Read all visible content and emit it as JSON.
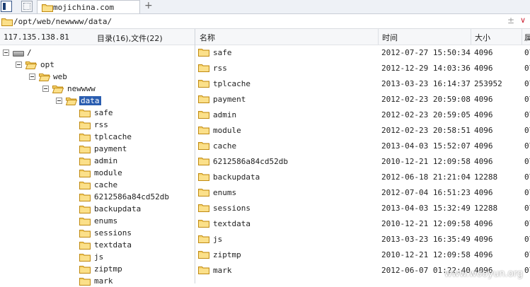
{
  "tab": {
    "title": "mojichina.com",
    "new_tab": "+"
  },
  "pathbar": {
    "path": "/opt/web/newwww/data/",
    "up_icon": "±",
    "dropdown_icon": "∨"
  },
  "info": {
    "ip": "117.135.138.81",
    "summary": "目录(16),文件(22)"
  },
  "columns": {
    "name": "名称",
    "time": "时间",
    "size": "大小",
    "perm": "属"
  },
  "tree": {
    "root": "/",
    "opt": "opt",
    "web": "web",
    "newwww": "newwww",
    "data": "data",
    "children": [
      "safe",
      "rss",
      "tplcache",
      "payment",
      "admin",
      "module",
      "cache",
      "6212586a84cd52db",
      "backupdata",
      "enums",
      "sessions",
      "textdata",
      "js",
      "ziptmp",
      "mark"
    ]
  },
  "files": [
    {
      "name": "safe",
      "time": "2012-07-27 15:50:34",
      "size": "4096",
      "perm": "07"
    },
    {
      "name": "rss",
      "time": "2012-12-29 14:03:36",
      "size": "4096",
      "perm": "07"
    },
    {
      "name": "tplcache",
      "time": "2013-03-23 16:14:37",
      "size": "253952",
      "perm": "07"
    },
    {
      "name": "payment",
      "time": "2012-02-23 20:59:08",
      "size": "4096",
      "perm": "07"
    },
    {
      "name": "admin",
      "time": "2012-02-23 20:59:05",
      "size": "4096",
      "perm": "07"
    },
    {
      "name": "module",
      "time": "2012-02-23 20:58:51",
      "size": "4096",
      "perm": "07"
    },
    {
      "name": "cache",
      "time": "2013-04-03 15:52:07",
      "size": "4096",
      "perm": "07"
    },
    {
      "name": "6212586a84cd52db",
      "time": "2010-12-21 12:09:58",
      "size": "4096",
      "perm": "07"
    },
    {
      "name": "backupdata",
      "time": "2012-06-18 21:21:04",
      "size": "12288",
      "perm": "07"
    },
    {
      "name": "enums",
      "time": "2012-07-04 16:51:23",
      "size": "4096",
      "perm": "07"
    },
    {
      "name": "sessions",
      "time": "2013-04-03 15:32:49",
      "size": "12288",
      "perm": "07"
    },
    {
      "name": "textdata",
      "time": "2010-12-21 12:09:58",
      "size": "4096",
      "perm": "07"
    },
    {
      "name": "js",
      "time": "2013-03-23 16:35:49",
      "size": "4096",
      "perm": "07"
    },
    {
      "name": "ziptmp",
      "time": "2010-12-21 12:09:58",
      "size": "4096",
      "perm": "07"
    },
    {
      "name": "mark",
      "time": "2012-06-07 01:22:40",
      "size": "4096",
      "perm": "07"
    }
  ],
  "watermark": "www.wooyun.org",
  "colors": {
    "folder": "#e8b624",
    "selection": "#2a5db0"
  }
}
